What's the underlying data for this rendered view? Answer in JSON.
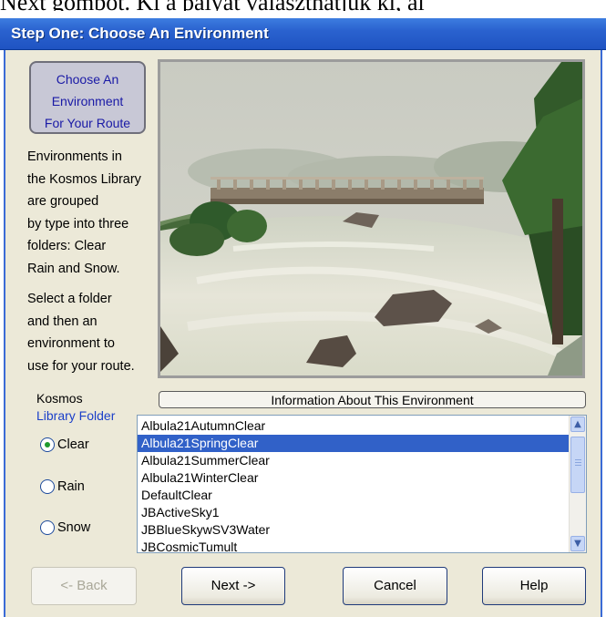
{
  "page_top_text": "Next gombot. Ki a pályát választhatjuk ki, al",
  "window": {
    "title": "Step One: Choose An Environment"
  },
  "callout": {
    "line1": "Choose An",
    "line2": "Environment",
    "line3": "For Your Route"
  },
  "description": {
    "para1": "Environments in\nthe Kosmos Library\nare grouped\nby type into three\nfolders: Clear\nRain and Snow.",
    "para2": "Select a folder\nand then an\nenvironment to\nuse for your route."
  },
  "info_button": "Information About This Environment",
  "library_label": {
    "line1": "Kosmos",
    "line2": "Library Folder"
  },
  "folders": [
    {
      "label": "Clear",
      "selected": true
    },
    {
      "label": "Rain",
      "selected": false
    },
    {
      "label": "Snow",
      "selected": false
    }
  ],
  "environments": {
    "selected": "Albula21SpringClear",
    "items": [
      "Albula21AutumnClear",
      "Albula21SpringClear",
      "Albula21SummerClear",
      "Albula21WinterClear",
      "DefaultClear",
      "JBActiveSky1",
      "JBBlueSkywSV3Water",
      "JBCosmicTumult"
    ]
  },
  "buttons": {
    "back": "<- Back",
    "next": "Next ->",
    "cancel": "Cancel",
    "help": "Help"
  },
  "colors": {
    "titlebar": "#2a62cf",
    "selection": "#3161c8",
    "dialog_bg": "#ece9d8",
    "callout_text": "#1a1aa6"
  }
}
